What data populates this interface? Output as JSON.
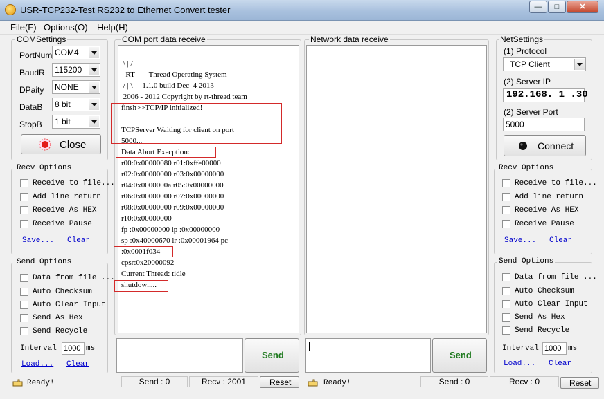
{
  "window": {
    "title": "USR-TCP232-Test  RS232 to Ethernet Convert tester",
    "minimize_glyph": "—",
    "maximize_glyph": "□",
    "close_glyph": "✕"
  },
  "menu": [
    "File(F)",
    "Options(O)",
    "Help(H)"
  ],
  "com_settings": {
    "title": "COMSettings",
    "fields": [
      {
        "label": "PortNum",
        "value": "COM4"
      },
      {
        "label": "BaudR",
        "value": "115200"
      },
      {
        "label": "DPaity",
        "value": "NONE"
      },
      {
        "label": "DataB",
        "value": "8 bit"
      },
      {
        "label": "StopB",
        "value": "1 bit"
      }
    ],
    "close_button": "Close"
  },
  "left_recv_options": {
    "title": "Recv Options",
    "items": [
      "Receive to file...",
      "Add line return",
      "Receive As HEX",
      "Receive Pause"
    ],
    "save_link": "Save...",
    "clear_link": "Clear"
  },
  "left_send_options": {
    "title": "Send Options",
    "items": [
      "Data from file ...",
      "Auto Checksum",
      "Auto Clear Input",
      "Send As Hex",
      "Send Recycle"
    ],
    "interval_label": "Interval",
    "interval_value": "1000",
    "interval_unit": "ms",
    "load_link": "Load...",
    "clear_link": "Clear"
  },
  "com_receive": {
    "title": "COM port data receive",
    "lines": [
      " \\ | /",
      "- RT -     Thread Operating System",
      " / | \\     1.1.0 build Dec  4 2013",
      " 2006 - 2012 Copyright by rt-thread team",
      "finsh>>TCP/IP initialized!",
      "",
      "TCPServer Waiting for client on port",
      "5000...",
      "Data Abort Execption:",
      "r00:0x00000080 r01:0xffe00000",
      "r02:0x00000000 r03:0x00000000",
      "r04:0x0000000a r05:0x00000000",
      "r06:0x00000000 r07:0x00000000",
      "r08:0x00000000 r09:0x00000000",
      "r10:0x00000000",
      "fp :0x00000000 ip :0x00000000",
      "sp :0x40000670 lr :0x00001964 pc",
      ":0x0001f034",
      "cpsr:0x20000092",
      "Current Thread: tidle",
      "shutdown..."
    ]
  },
  "network_receive": {
    "title": "Network data receive"
  },
  "send_left": {
    "button": "Send"
  },
  "send_right": {
    "button": "Send"
  },
  "net_settings": {
    "title": "NetSettings",
    "protocol_label": "(1) Protocol",
    "protocol_value": "TCP Client",
    "server_ip_label": "(2) Server IP",
    "server_ip_value": "192.168. 1 .30",
    "server_port_label": "(2) Server Port",
    "server_port_value": "5000",
    "connect_button": "Connect"
  },
  "right_recv_options": {
    "title": "Recv Options",
    "items": [
      "Receive to file...",
      "Add line return",
      "Receive As HEX",
      "Receive Pause"
    ],
    "save_link": "Save...",
    "clear_link": "Clear"
  },
  "right_send_options": {
    "title": "Send Options",
    "items": [
      "Data from file ...",
      "Auto Checksum",
      "Auto Clear Input",
      "Send As Hex",
      "Send Recycle"
    ],
    "interval_label": "Interval",
    "interval_value": "1000",
    "interval_unit": "ms",
    "load_link": "Load...",
    "clear_link": "Clear"
  },
  "status_left": {
    "ready": "Ready!",
    "send": "Send : 0",
    "recv": "Recv : 2001",
    "reset": "Reset"
  },
  "status_right": {
    "ready": "Ready!",
    "send": "Send : 0",
    "recv": "Recv : 0",
    "reset": "Reset"
  },
  "colors": {
    "accent_red": "#d32a2a",
    "link_blue": "#0000cc",
    "send_green": "#1f7a1f"
  }
}
